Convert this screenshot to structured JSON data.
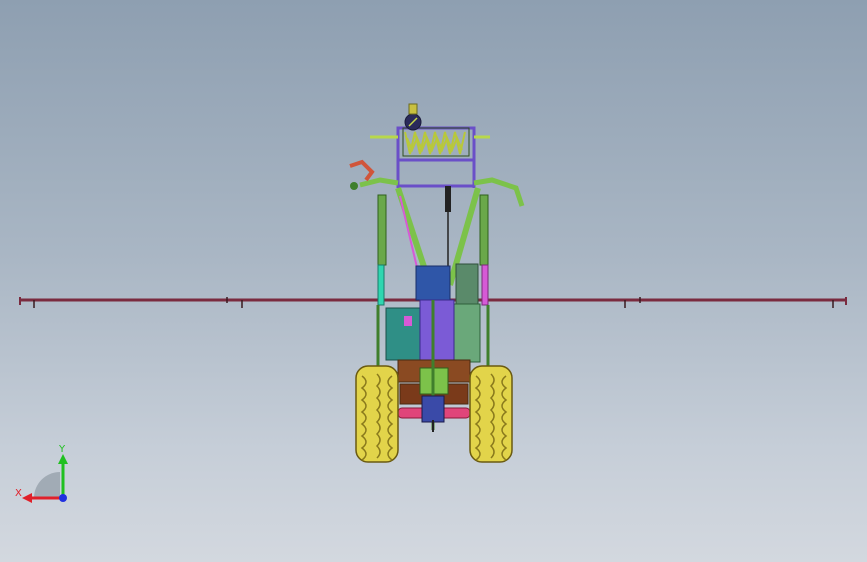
{
  "viewport": {
    "background_top": "#8e9fb1",
    "background_bottom": "#d3d8df"
  },
  "model": {
    "colors": {
      "boom": "#7a2b3f",
      "frame_green": "#7cc24a",
      "frame_dark_green": "#3f7f2c",
      "purple": "#7b5bd6",
      "magenta": "#d65ad6",
      "tank_blue": "#2f56a8",
      "teal": "#2f8f86",
      "brown": "#8a4a22",
      "pink": "#e0457a",
      "tire": "#e2d44a",
      "tire_dark": "#8a7a1c",
      "coil": "#c8d84a",
      "nozzle_red": "#d0553a"
    }
  },
  "triad": {
    "x_label": "X",
    "y_label": "Y",
    "x_color": "#e0202a",
    "y_color": "#20c020",
    "z_color": "#2030e0"
  }
}
